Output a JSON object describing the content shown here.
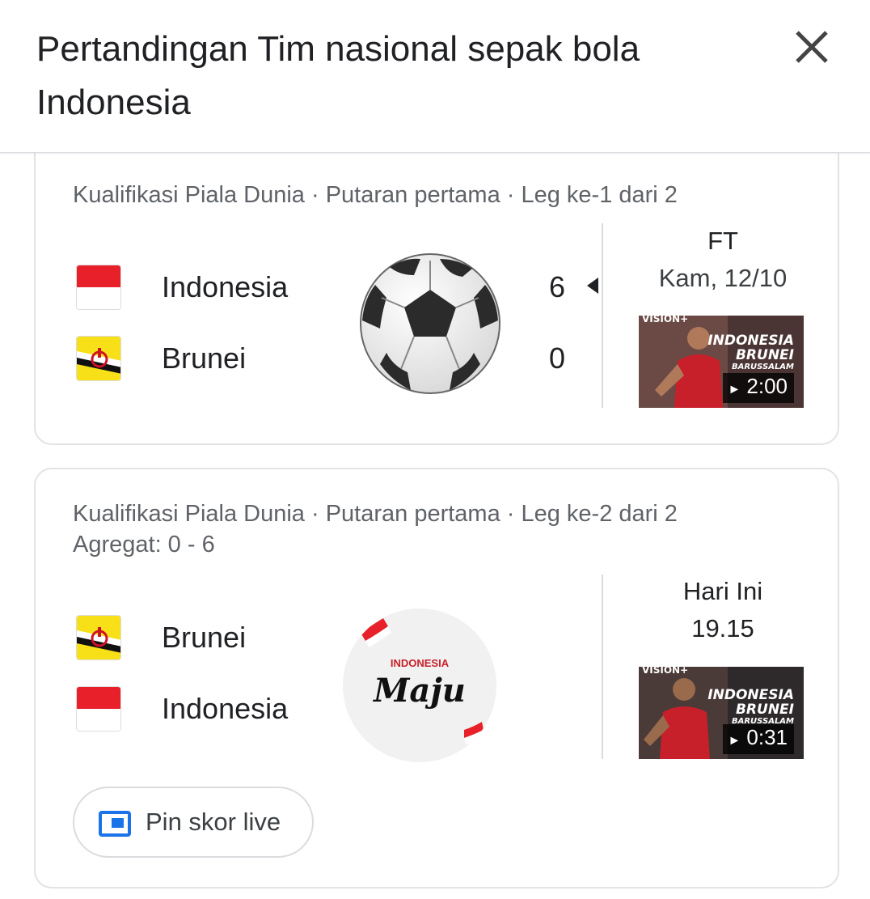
{
  "header": {
    "title": "Pertandingan Tim nasional sepak bola Indonesia",
    "close_icon": "close-icon"
  },
  "matches": [
    {
      "competition": "Kualifikasi Piala Dunia · Putaran pertama · Leg ke-1 dari 2",
      "aggregate": "",
      "teams": [
        {
          "name": "Indonesia",
          "score": "6",
          "flag": "indonesia-flag",
          "winner": true
        },
        {
          "name": "Brunei",
          "score": "0",
          "flag": "brunei-flag",
          "winner": false
        }
      ],
      "center_image": "soccer-ball",
      "status": "FT",
      "date": "Kam, 12/10",
      "video": {
        "duration": "2:00",
        "overlay_text": [
          "INDONESIA",
          "BRUNEI",
          "BARUSSALAM"
        ],
        "brand": "VISION+"
      }
    },
    {
      "competition": "Kualifikasi Piala Dunia · Putaran pertama · Leg ke-2 dari 2",
      "aggregate": "Agregat: 0 - 6",
      "teams": [
        {
          "name": "Brunei",
          "flag": "brunei-flag"
        },
        {
          "name": "Indonesia",
          "flag": "indonesia-flag"
        }
      ],
      "center_image": {
        "top": "INDONESIA",
        "script": "Maju"
      },
      "status": "Hari Ini",
      "date": "19.15",
      "video": {
        "duration": "0:31",
        "overlay_text": [
          "INDONESIA",
          "BRUNEI",
          "BARUSSALAM"
        ],
        "brand": "VISION+"
      },
      "pin_button": {
        "label": "Pin skor live",
        "icon": "pin-live-icon"
      }
    }
  ],
  "colors": {
    "indonesia_red": "#e8202a",
    "brunei_yellow": "#f7e017",
    "border": "#e3e3e3",
    "secondary_text": "#5f6368",
    "pin_icon_blue": "#1a73e8"
  }
}
